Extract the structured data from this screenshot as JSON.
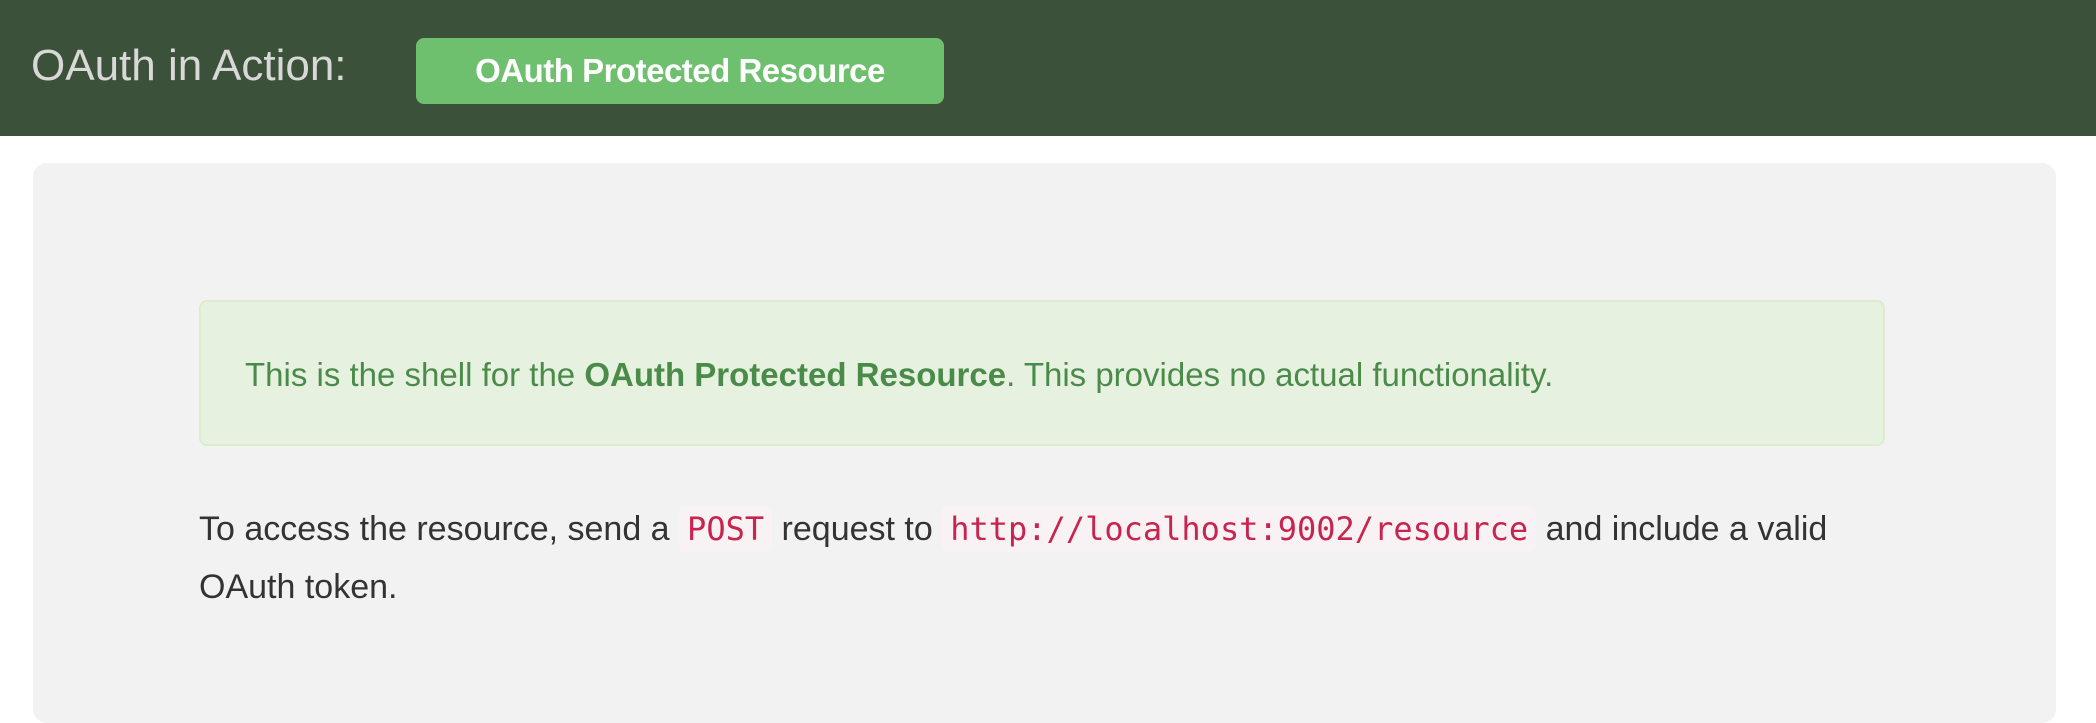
{
  "header": {
    "brand": "OAuth in Action:",
    "badge": "OAuth Protected Resource"
  },
  "alert": {
    "prefix": "This is the shell for the ",
    "strong": "OAuth Protected Resource",
    "suffix": ". This provides no actual functionality."
  },
  "info": {
    "part1": "To access the resource, send a ",
    "method": "POST",
    "part2": " request to ",
    "url": "http://localhost:9002/resource",
    "part3": " and include a valid OAuth token."
  },
  "colors": {
    "navbar": "#3b5139",
    "badge": "#6fc06e",
    "alert_bg": "#e6f1e0",
    "alert_text": "#4a8b4a",
    "code_text": "#c7254e"
  }
}
